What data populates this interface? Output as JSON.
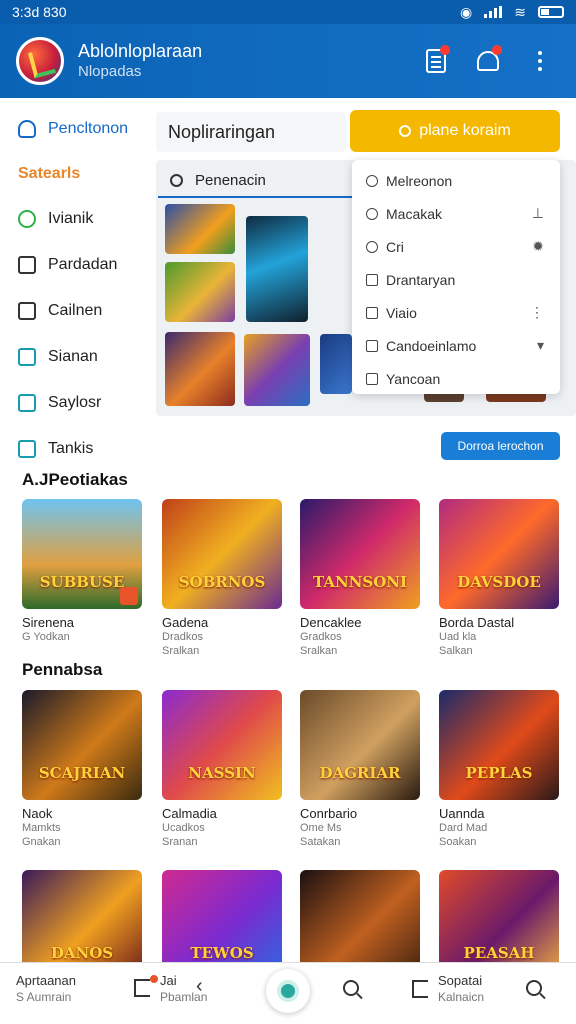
{
  "status": {
    "time": "3:3d 830"
  },
  "header": {
    "title": "Ablolnloplaraan",
    "subtitle": "Nlopadas"
  },
  "sidebar": {
    "items": [
      {
        "label": "Pencltonon"
      },
      {
        "label": "Ivianik"
      },
      {
        "label": "Pardadan"
      },
      {
        "label": "Cailnen"
      },
      {
        "label": "Sianan"
      },
      {
        "label": "Saylosr"
      },
      {
        "label": "Tankis"
      }
    ],
    "section_label": "Satearls"
  },
  "panel": {
    "title": "Nopliraringan",
    "cta_label": "plane koraim",
    "search_placeholder": "Penenacin",
    "small_button": "Dorroa lerochon"
  },
  "dropdown": {
    "items": [
      {
        "label": "Melreonon"
      },
      {
        "label": "Macakak"
      },
      {
        "label": "Cri"
      },
      {
        "label": "Drantaryan"
      },
      {
        "label": "Viaio"
      },
      {
        "label": "Candoeinlamo"
      },
      {
        "label": "Yancoan"
      }
    ]
  },
  "sections": [
    {
      "title": "A.JPeotiakas",
      "cards": [
        {
          "art": "SUBBUSE",
          "name": "Sirenena",
          "meta1": "G Yodkan",
          "meta2": ""
        },
        {
          "art": "SOBRNOS",
          "name": "Gadena",
          "meta1": "Dradkos",
          "meta2": "Sralkan"
        },
        {
          "art": "TANNSONI",
          "name": "Dencaklee",
          "meta1": "Gradkos",
          "meta2": "Sralkan"
        },
        {
          "art": "DAVSDOE",
          "name": "Borda Dastal",
          "meta1": "Uad kla",
          "meta2": "Salkan"
        }
      ]
    },
    {
      "title": "Pennabsa",
      "cards": [
        {
          "art": "SCAJRIAN",
          "name": "Naok",
          "meta1": "Mamkts",
          "meta2": "Gnakan"
        },
        {
          "art": "NASSIN",
          "name": "Calmadia",
          "meta1": "Ucadkos",
          "meta2": "Sranan"
        },
        {
          "art": "DAGRIAR",
          "name": "Conrbario",
          "meta1": "Ome Ms",
          "meta2": "Satakan"
        },
        {
          "art": "PEPLAS",
          "name": "Uannda",
          "meta1": "Dard Mad",
          "meta2": "Soakan"
        }
      ]
    },
    {
      "cards": [
        {
          "art": "DANOS"
        },
        {
          "art": "TEWOS"
        },
        {
          "art": ""
        },
        {
          "art": "PEASAH"
        }
      ]
    }
  ],
  "bottom_nav": {
    "left_label": "Aprtaanan",
    "left_sub": "S Aumrain",
    "mid_label": "Jai",
    "mid_sub": "Pbamlan",
    "right_label": "Sopatai",
    "right_sub": "Kalnaicn"
  }
}
